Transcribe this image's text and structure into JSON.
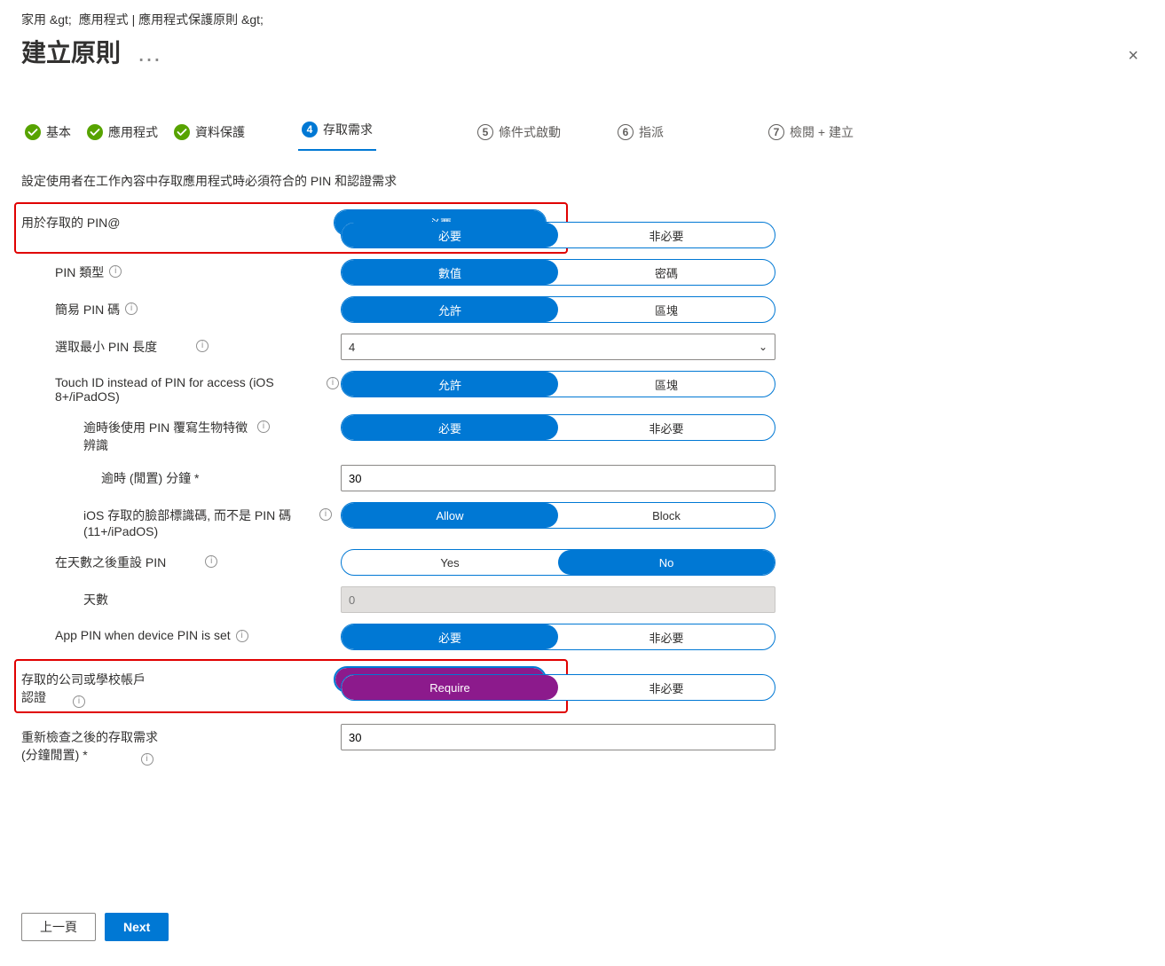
{
  "breadcrumb": [
    "家用 &gt;",
    "應用程式 | 應用程式保護原則 &gt;"
  ],
  "title": "建立原則",
  "title_dots": "…",
  "close_label": "×",
  "steps": [
    {
      "num": "",
      "label": "基本",
      "state": "done"
    },
    {
      "num": "",
      "label": "應用程式",
      "state": "done"
    },
    {
      "num": "",
      "label": "資料保護",
      "state": "done"
    },
    {
      "num": "4",
      "label": "存取需求",
      "state": "current"
    },
    {
      "num": "5",
      "label": "條件式啟動",
      "state": "future"
    },
    {
      "num": "6",
      "label": "指派",
      "state": "future"
    },
    {
      "num": "7",
      "label": "檢閱 + 建立",
      "state": "future"
    }
  ],
  "intro": "設定使用者在工作內容中存取應用程式時必須符合的 PIN 和認證需求",
  "rows": {
    "pin_access": {
      "label": "用於存取的 PIN@",
      "optA": "必要",
      "optB": "非必要",
      "sel": "A"
    },
    "pin_type": {
      "label": "PIN 類型",
      "optA": "數值",
      "optB": "密碼",
      "sel": "A",
      "info": true
    },
    "simple_pin": {
      "label": "簡易 PIN 碼",
      "optA": "允許",
      "optB": "區塊",
      "sel": "A",
      "info": true
    },
    "min_len": {
      "label": "選取最小 PIN 長度",
      "value": "4",
      "info": true
    },
    "touchid": {
      "label": "Touch ID instead of PIN for access (iOS 8+/iPadOS)",
      "optA": "允許",
      "optB": "區塊",
      "sel": "A",
      "info": true
    },
    "override": {
      "label": "逾時後使用 PIN 覆寫生物特徵辨識",
      "optA": "必要",
      "optB": "非必要",
      "sel": "A",
      "info": true
    },
    "timeout": {
      "label": "逾時 (閒置) 分鐘 *",
      "value": "30"
    },
    "faceid": {
      "label": "iOS 存取的臉部標識碼, 而不是 PIN 碼 (11+/iPadOS)",
      "optA": "Allow",
      "optB": "Block",
      "sel": "A",
      "info": true
    },
    "reset_days": {
      "label": "在天數之後重設 PIN",
      "optA": "Yes",
      "optB": "No",
      "sel": "B",
      "info": true
    },
    "days": {
      "label": "天數",
      "value": "0",
      "disabled": true
    },
    "app_pin": {
      "label": "App PIN when device PIN is set",
      "optA": "必要",
      "optB": "非必要",
      "sel": "A",
      "info": true
    },
    "work_acct": {
      "label_l1": "存取的公司或學校帳戶",
      "label_l2": "認證",
      "optA": "Require",
      "optB": "非必要",
      "sel": "A",
      "info": true,
      "purple": true
    },
    "recheck": {
      "label_l1": "重新檢查之後的存取需求",
      "label_l2": "(分鐘閒置) *",
      "value": "30",
      "info": true
    }
  },
  "buttons": {
    "back": "上一頁",
    "next": "Next"
  }
}
